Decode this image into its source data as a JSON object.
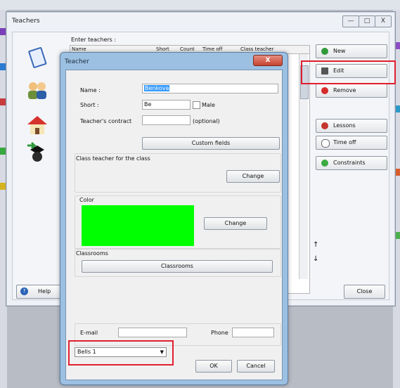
{
  "outer_window": {
    "title": "Teachers",
    "minimize": "—",
    "maximize": "□",
    "close": "X",
    "enter_label": "Enter teachers :",
    "columns": [
      "Name",
      "Short",
      "Count",
      "Time off",
      "Class teacher"
    ],
    "buttons": {
      "new": "New",
      "edit": "Edit",
      "remove": "Remove",
      "lessons": "Lessons",
      "time_off": "Time off",
      "constraints": "Constraints",
      "help": "Help",
      "close": "Close"
    },
    "arrow_up": "↑",
    "arrow_down": "↓"
  },
  "teacher_dialog": {
    "title": "Teacher",
    "close": "X",
    "name_label": "Name :",
    "name_value": "Benkova",
    "short_label": "Short :",
    "short_value": "Be",
    "male_label": "Male",
    "contract_label": "Teacher's contract",
    "optional_text": "(optional)",
    "custom_fields_button": "Custom fields",
    "class_teacher_label": "Class teacher for the class",
    "change_button": "Change",
    "color_label": "Color",
    "color_change_button": "Change",
    "color_value": "#00ff00",
    "classrooms_label": "Classrooms",
    "classrooms_button": "Classrooms",
    "email_label": "E-mail",
    "phone_label": "Phone",
    "bells_value": "Bells 1",
    "ok_button": "OK",
    "cancel_button": "Cancel"
  },
  "colors": {
    "highlight": "#e11f30",
    "accent": "#3399ff"
  }
}
